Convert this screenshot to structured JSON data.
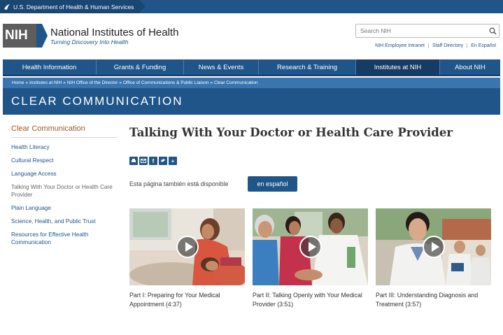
{
  "hhs_bar": {
    "label": "U.S. Department of Health & Human Services"
  },
  "header": {
    "logo_abbr": "NIH",
    "title": "National Institutes of Health",
    "tagline": "Turning Discovery Into Health",
    "search_placeholder": "Search NIH",
    "util_links": [
      "NIH Employee Intranet",
      "Staff Directory",
      "En Español"
    ]
  },
  "nav": {
    "items": [
      "Health Information",
      "Grants & Funding",
      "News & Events",
      "Research & Training",
      "Institutes at NIH",
      "About NIH"
    ],
    "active": "Institutes at NIH"
  },
  "breadcrumb": [
    "Home",
    "Institutes at NIH",
    "NIH Office of the Director",
    "Office of Communications & Public Liaison",
    "Clear Communication"
  ],
  "section_title": "CLEAR COMMUNICATION",
  "sidebar": {
    "heading": "Clear Communication",
    "items": [
      "Health Literacy",
      "Cultural Respect",
      "Language Access",
      "Talking With Your Doctor or Health Care Provider",
      "Plain Language",
      "Science, Health, and Public Trust",
      "Resources for Effective Health Communication"
    ],
    "current": "Talking With Your Doctor or Health Care Provider"
  },
  "main": {
    "title": "Talking With Your Doctor or Health Care Provider",
    "share_icons": [
      "print-icon",
      "email-icon",
      "facebook-icon",
      "twitter-icon",
      "plus-icon"
    ],
    "spanish_text": "Esta página también está disponible",
    "spanish_button": "en español",
    "videos": [
      {
        "caption": "Part I: Preparing for Your Medical Appointment (4:37)"
      },
      {
        "caption": "Part II: Talking Openly with Your Medical Provider (3:51)"
      },
      {
        "caption": "Part III: Understanding Diagnosis and Treatment (3:57)"
      }
    ]
  },
  "colors": {
    "brand_blue": "#20558a",
    "dark_blue": "#163c65",
    "crumb_blue": "#3a75ae",
    "sidebar_heading": "#9b5c22"
  }
}
